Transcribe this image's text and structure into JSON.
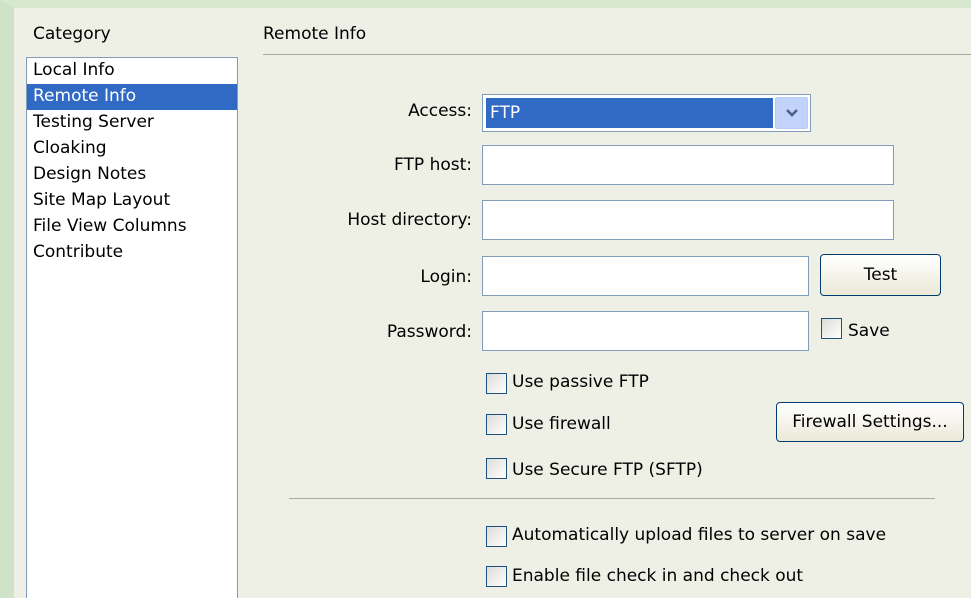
{
  "category": {
    "header": "Category",
    "items": [
      "Local Info",
      "Remote Info",
      "Testing Server",
      "Cloaking",
      "Design Notes",
      "Site Map Layout",
      "File View Columns",
      "Contribute"
    ],
    "selected": "Remote Info"
  },
  "section": {
    "title": "Remote Info"
  },
  "form": {
    "access_label": "Access:",
    "access_value": "FTP",
    "ftp_host_label": "FTP host:",
    "ftp_host_value": "",
    "host_dir_label": "Host directory:",
    "host_dir_value": "",
    "login_label": "Login:",
    "login_value": "",
    "password_label": "Password:",
    "password_value": "",
    "test_button": "Test",
    "save_label": "Save",
    "passive_ftp_label": "Use passive FTP",
    "firewall_label": "Use firewall",
    "firewall_settings_button": "Firewall Settings...",
    "sftp_label": "Use Secure FTP (SFTP)",
    "auto_upload_label": "Automatically upload files to server on save",
    "check_in_out_label": "Enable file check in and check out"
  },
  "icons": {
    "dropdown": "chevron-down-icon"
  },
  "colors": {
    "selection": "#316ac5",
    "input_border": "#7f9db9",
    "button_border": "#003c74"
  }
}
